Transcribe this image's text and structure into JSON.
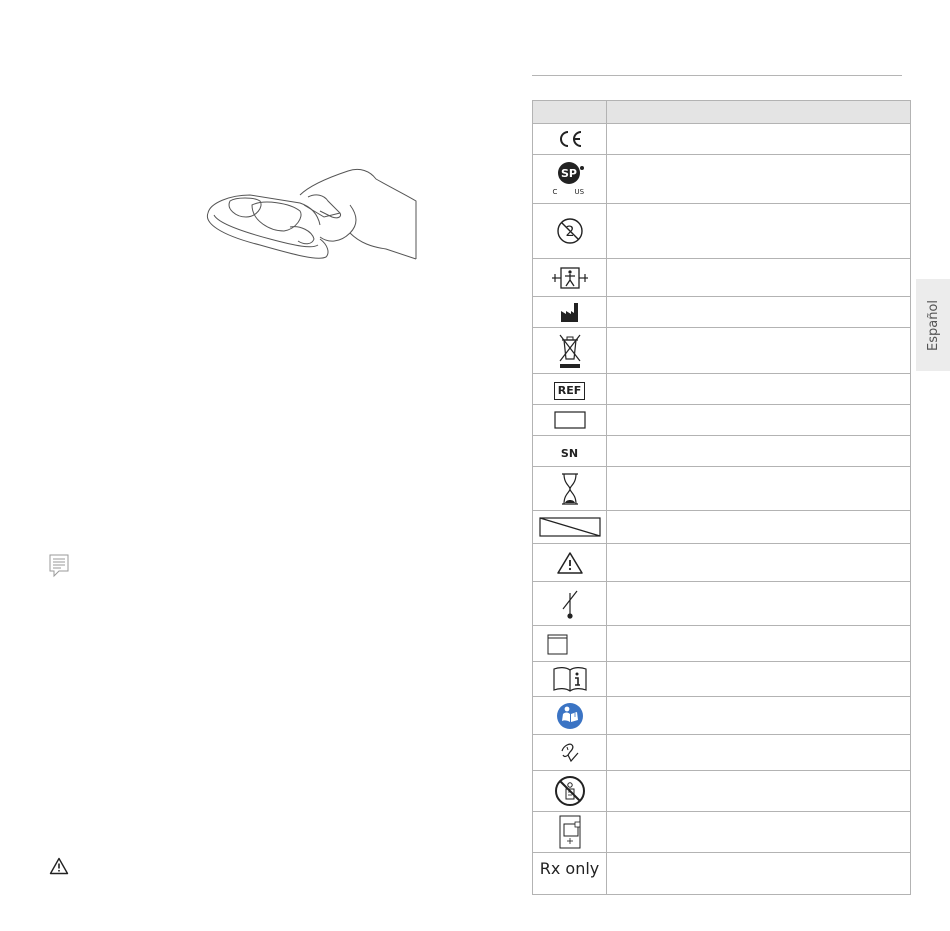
{
  "page": {
    "language_tab": "Español"
  },
  "symbols_table": {
    "header": {
      "symbol": "",
      "description": ""
    },
    "rows": [
      {
        "icon": "ce-mark-icon",
        "text": ""
      },
      {
        "icon": "csa-mark-icon",
        "text": "",
        "sub_left": "C",
        "sub_right": "US"
      },
      {
        "icon": "do-not-reuse-icon",
        "text": ""
      },
      {
        "icon": "type-bf-applied-part-icon",
        "text": ""
      },
      {
        "icon": "manufacturer-icon",
        "text": ""
      },
      {
        "icon": "weee-disposal-icon",
        "text": ""
      },
      {
        "icon": "ref-catalog-number-icon",
        "text": "REF"
      },
      {
        "icon": "lot-box-icon",
        "text": ""
      },
      {
        "icon": "serial-number-icon",
        "text": "SN"
      },
      {
        "icon": "use-by-date-icon",
        "text": ""
      },
      {
        "icon": "date-box-icon",
        "text": ""
      },
      {
        "icon": "caution-icon",
        "text": ""
      },
      {
        "icon": "temperature-limit-icon",
        "text": ""
      },
      {
        "icon": "sterile-box-icon",
        "text": ""
      },
      {
        "icon": "consult-instructions-icon",
        "text": ""
      },
      {
        "icon": "follow-instructions-icon",
        "text": ""
      },
      {
        "icon": "keep-dry-icon",
        "text": ""
      },
      {
        "icon": "no-mri-icon",
        "text": ""
      },
      {
        "icon": "device-port-icon",
        "text": ""
      },
      {
        "icon": "rx-only-icon",
        "text": "Rx only"
      }
    ]
  },
  "colors": {
    "header_fill": "#e4e4e4",
    "border": "#b3b3b3",
    "tab_fill": "#ececec",
    "blue_icon": "#3b74c4"
  }
}
